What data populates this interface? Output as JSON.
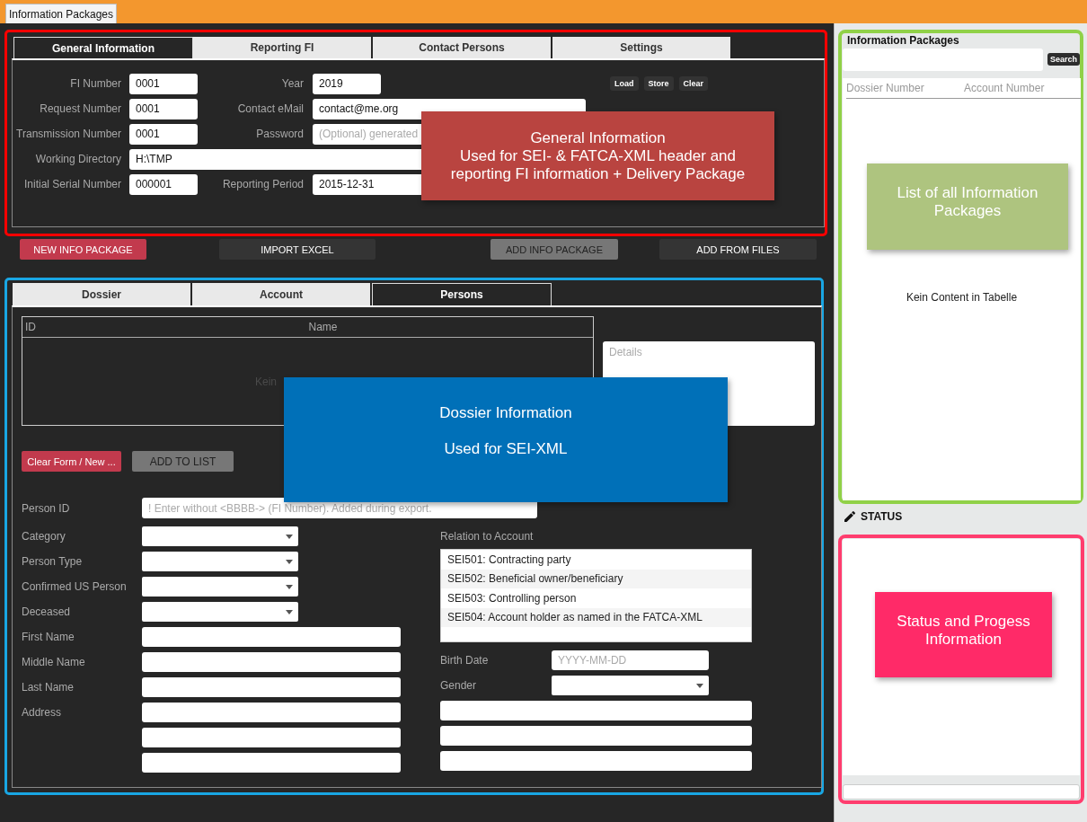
{
  "app_tab": {
    "label": "Information Packages"
  },
  "general_panel": {
    "tabs": [
      {
        "label": "General Information",
        "selected": true
      },
      {
        "label": "Reporting FI",
        "selected": false
      },
      {
        "label": "Contact Persons",
        "selected": false
      },
      {
        "label": "Settings",
        "selected": false
      }
    ],
    "rows": [
      {
        "left": {
          "label": "FI Number",
          "value": "0001",
          "kind": "short"
        },
        "right": {
          "label": "Year",
          "value": "2019",
          "kind": "short"
        }
      },
      {
        "left": {
          "label": "Request Number",
          "value": "0001",
          "kind": "short"
        },
        "right": {
          "label": "Contact eMail",
          "value": "contact@me.org",
          "kind": "wide"
        }
      },
      {
        "left": {
          "label": "Transmission Number",
          "value": "0001",
          "kind": "short"
        },
        "right": {
          "label": "Password",
          "placeholder": "(Optional) generated",
          "kind": "wide"
        }
      },
      {
        "left": {
          "label": "Working Directory",
          "value": "H:\\TMP",
          "kind": "full"
        }
      },
      {
        "left": {
          "label": "Initial Serial Number",
          "value": "000001",
          "kind": "short"
        },
        "right": {
          "label": "Reporting Period",
          "value": "2015-12-31",
          "kind": "wide"
        }
      }
    ],
    "actions": [
      "Load",
      "Store",
      "Clear"
    ]
  },
  "package_buttons": [
    {
      "label": "NEW INFO PACKAGE",
      "kind": "danger"
    },
    {
      "label": "IMPORT EXCEL",
      "kind": "dark"
    },
    {
      "label": "ADD INFO PACKAGE",
      "kind": "disabled"
    },
    {
      "label": "ADD FROM FILES",
      "kind": "dark"
    }
  ],
  "dossier_panel": {
    "tabs": [
      {
        "label": "Dossier",
        "selected": false
      },
      {
        "label": "Account",
        "selected": false
      },
      {
        "label": "Persons",
        "selected": true
      }
    ],
    "table": {
      "columns": [
        "ID",
        "Name"
      ],
      "empty_text": "Kein"
    },
    "details": {
      "placeholder": "Details"
    },
    "buttons": [
      {
        "label": "Clear Form / New ...",
        "kind": "danger"
      },
      {
        "label": "ADD TO LIST",
        "kind": "disabled"
      }
    ],
    "person_id": {
      "label": "Person ID",
      "placeholder": "! Enter without <BBBB-> (FI Number). Added during export."
    },
    "left_fields": [
      {
        "label": "Category",
        "kind": "select"
      },
      {
        "label": "Person Type",
        "kind": "select"
      },
      {
        "label": "Confirmed US Person",
        "kind": "select"
      },
      {
        "label": "Deceased",
        "kind": "select"
      },
      {
        "label": "First Name",
        "kind": "text"
      },
      {
        "label": "Middle Name",
        "kind": "text"
      },
      {
        "label": "Last Name",
        "kind": "text"
      },
      {
        "label": "Address",
        "kind": "text"
      },
      {
        "kind": "text"
      },
      {
        "kind": "text"
      }
    ],
    "relation": {
      "label": "Relation to Account",
      "items": [
        "SEI501: Contracting party",
        "SEI502: Beneficial owner/beneficiary",
        "SEI503: Controlling person",
        "SEI504: Account holder as named in the FATCA-XML"
      ]
    },
    "right_fields": [
      {
        "label": "Birth Date",
        "kind": "text",
        "placeholder": "YYYY-MM-DD"
      },
      {
        "label": "Gender",
        "kind": "select"
      },
      {
        "kind": "wide"
      },
      {
        "kind": "wide"
      },
      {
        "kind": "wide"
      }
    ]
  },
  "sidebar": {
    "title": "Information Packages",
    "search_button": "Search",
    "columns": [
      "Dossier Number",
      "Account Number"
    ],
    "empty_text": "Kein Content in Tabelle"
  },
  "status": {
    "title": "STATUS"
  },
  "annotations": [
    {
      "lines": [
        "General Information",
        "Used for SEI- & FATCA-XML header and reporting FI information + Delivery Package"
      ],
      "color": "#b94440"
    },
    {
      "lines": [
        "Dossier Information",
        "Used for SEI-XML"
      ],
      "color": "#0070b8"
    },
    {
      "lines": [
        "List of all Information Packages"
      ],
      "color": "#aec47f"
    },
    {
      "lines": [
        "Status and Progess Information"
      ],
      "color": "#ff2a68"
    }
  ]
}
